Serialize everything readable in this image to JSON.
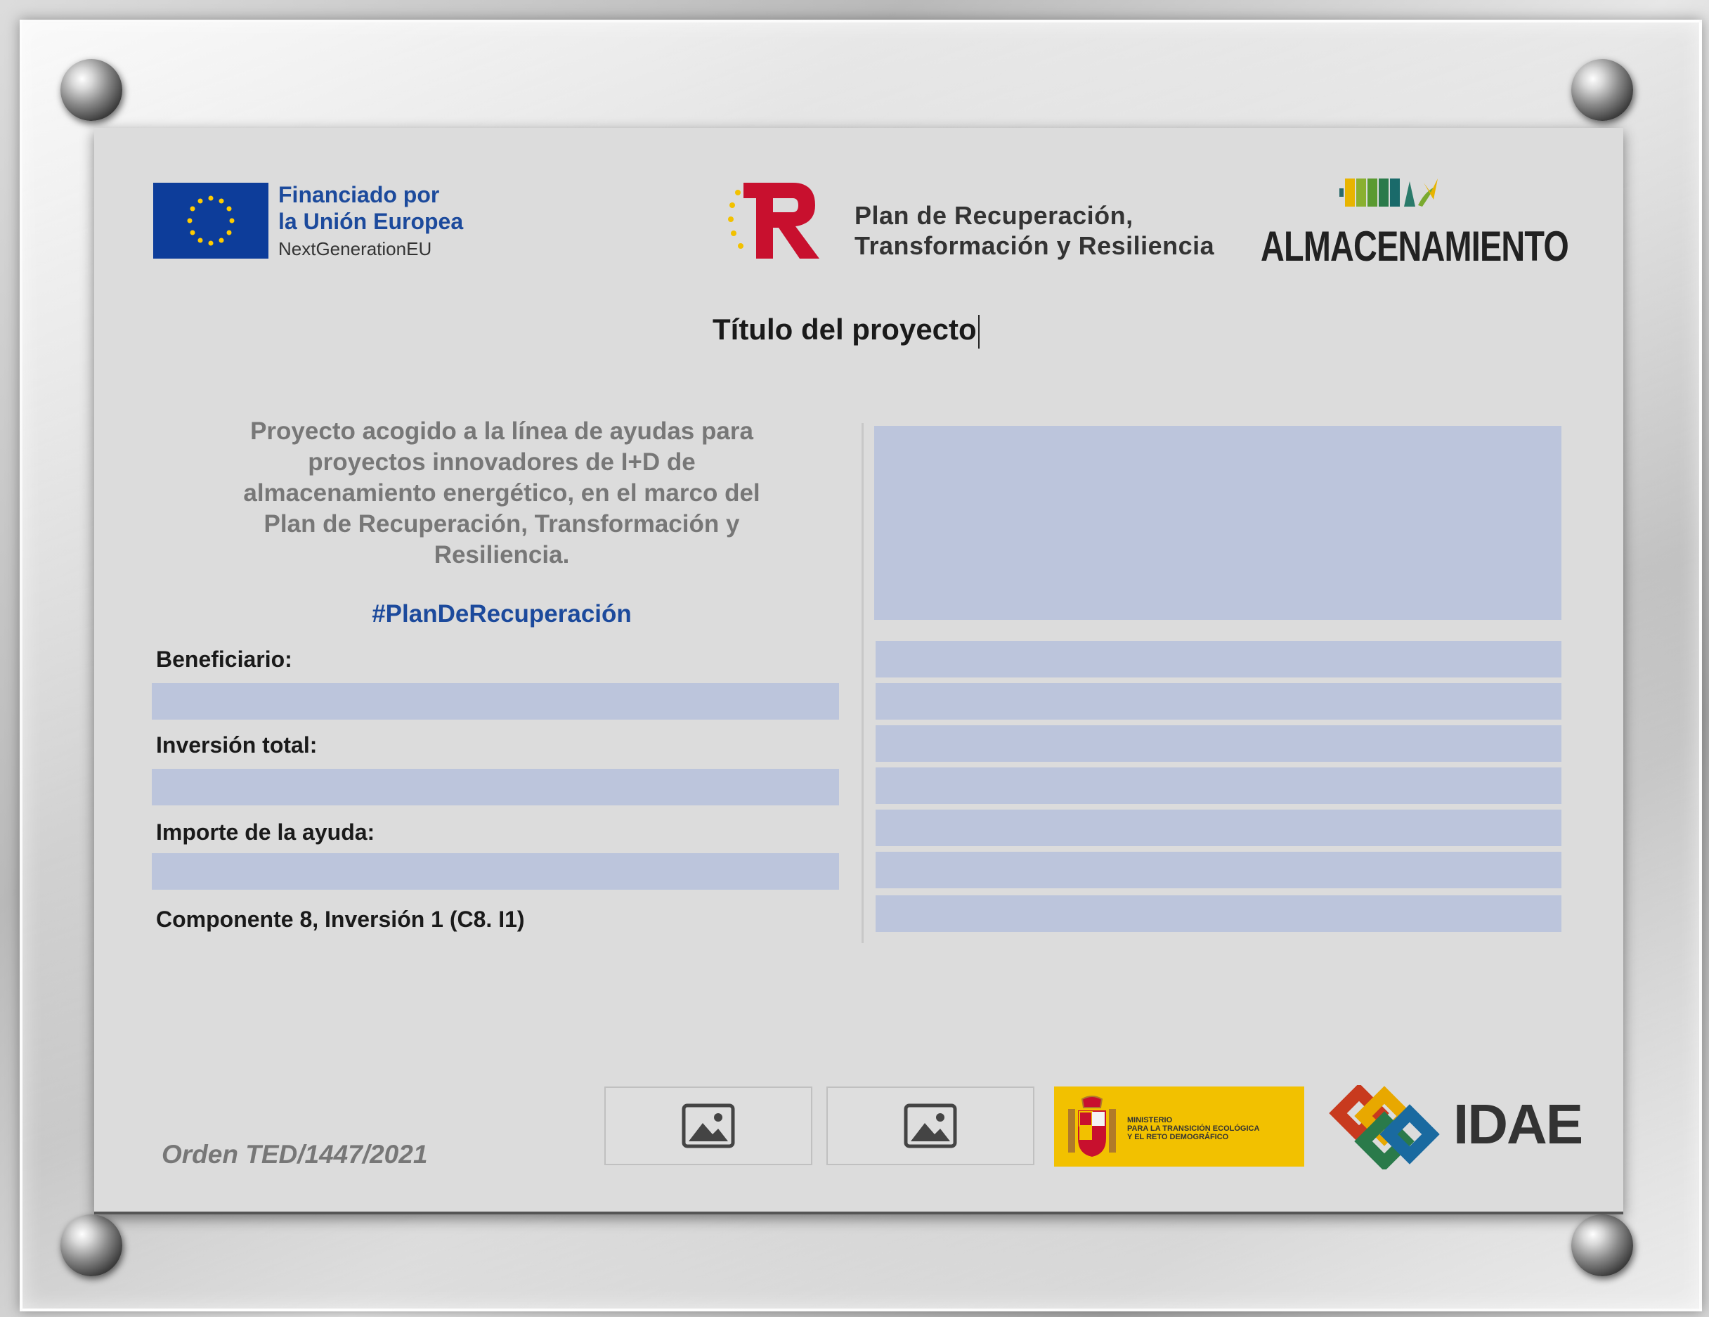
{
  "header": {
    "eu_line1": "Financiado por",
    "eu_line2": "la Unión Europea",
    "eu_sub": "NextGenerationEU",
    "plan_line1": "Plan de Recuperación,",
    "plan_line2": "Transformación y Resiliencia",
    "program": "ALMACENAMIENTO"
  },
  "title": "Título del proyecto",
  "left": {
    "description": "Proyecto acogido a la línea de ayudas para proyectos innovadores de I+D de almacenamiento energético, en el marco del Plan de Recuperación, Transformación y Resiliencia.",
    "hashtag": "#PlanDeRecuperación",
    "beneficiario_label": "Beneficiario:",
    "beneficiario_value": "",
    "inversion_label": "Inversión total:",
    "inversion_value": "",
    "importe_label": "Importe de la ayuda:",
    "importe_value": "",
    "componente": "Componente 8, Inversión 1 (C8. I1)"
  },
  "right": {
    "rows": [
      "",
      "",
      "",
      "",
      "",
      "",
      ""
    ]
  },
  "footer": {
    "orden": "Orden TED/1447/2021",
    "ministerio_line1": "MINISTERIO",
    "ministerio_line2": "PARA LA TRANSICIÓN ECOLÓGICA",
    "ministerio_line3": "Y EL RETO DEMOGRÁFICO",
    "idae": "IDAE"
  },
  "colors": {
    "eu_blue": "#0d3d9a",
    "field_blue": "#bcc5dc",
    "ministerio_yellow": "#f2c100",
    "tr_red": "#c8102e"
  },
  "icons": [
    "screw-icon",
    "eu-flag-icon",
    "tr-logo-icon",
    "almacenamiento-logo-icon",
    "image-placeholder-icon",
    "spain-coat-of-arms-icon",
    "idae-logo-icon"
  ]
}
